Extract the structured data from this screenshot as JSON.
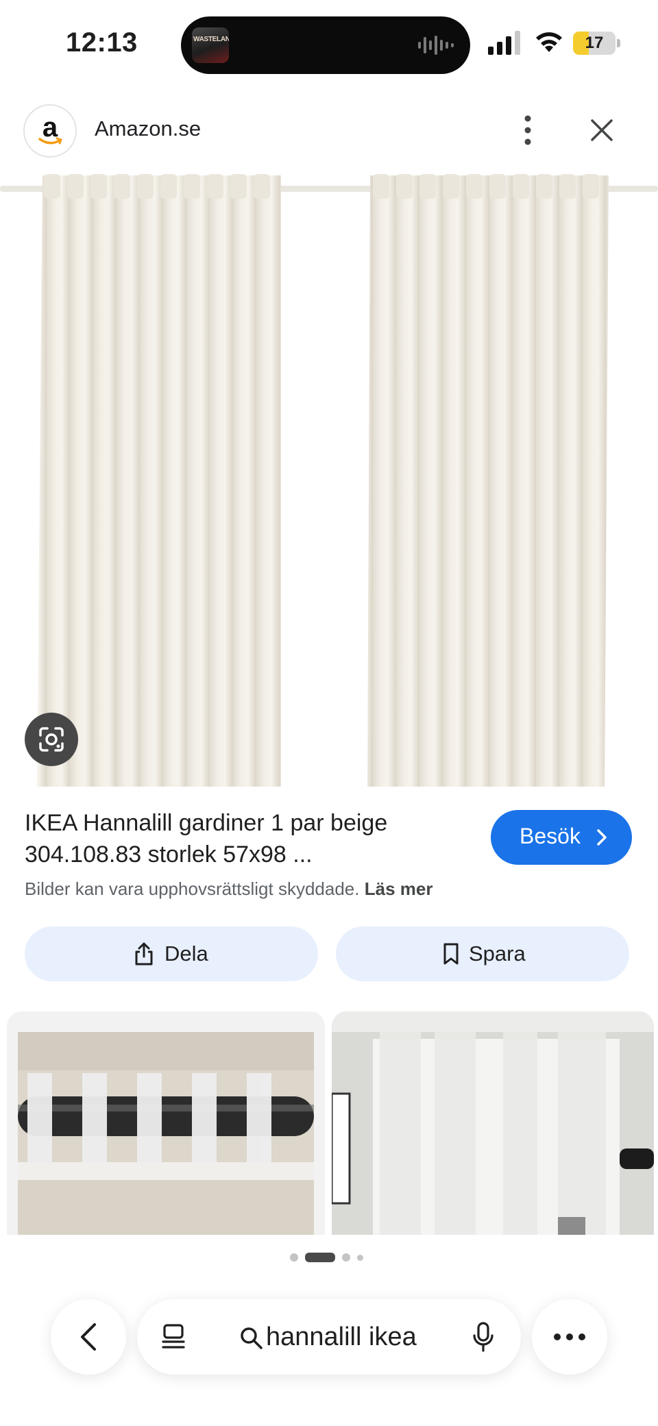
{
  "status_bar": {
    "time": "12:13",
    "now_playing_art_text": "WASTELAND",
    "battery_level": "17",
    "battery_fraction": 0.17
  },
  "source": {
    "logo_letter": "a",
    "site_name": "Amazon.se"
  },
  "result": {
    "title": "IKEA Hannalill gardiner 1 par beige 304.108.83 storlek 57x98 ...",
    "visit_label": "Besök",
    "disclaimer_text": "Bilder kan vara upphovsrättsligt skyddade.",
    "disclaimer_link": "Läs mer"
  },
  "actions": {
    "share_label": "Dela",
    "save_label": "Spara"
  },
  "pager": {
    "count": 4,
    "active_index": 1
  },
  "toolbar": {
    "query": "hannalill ikea"
  },
  "colors": {
    "accent_blue": "#1a73e8",
    "pill_bg": "#e8effd",
    "battery_yellow": "#f5cc2e"
  },
  "icons": {
    "back": "chevron-left-icon",
    "tabs": "tabs-icon",
    "search": "search-icon",
    "mic": "mic-icon",
    "more": "more-horiz-icon",
    "share": "share-icon",
    "save": "bookmark-icon",
    "lens": "google-lens-icon",
    "close": "close-icon",
    "menu": "more-vert-icon"
  }
}
